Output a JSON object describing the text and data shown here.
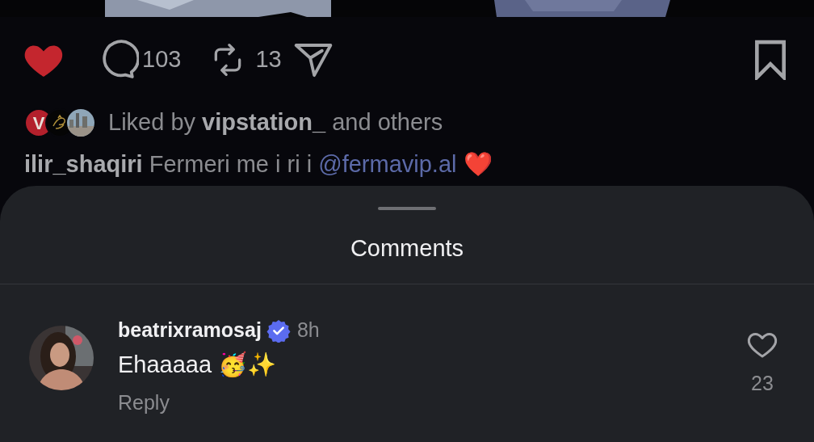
{
  "post": {
    "liked": true,
    "comment_count": "103",
    "repost_count": "13",
    "saved": false,
    "liked_by": {
      "avatars": [
        {
          "kind": "letter",
          "text": "V",
          "color": "#b3202c"
        },
        {
          "kind": "emblem"
        },
        {
          "kind": "picture"
        }
      ],
      "text": "Liked by **vipstation_** and others"
    },
    "caption": {
      "text": "**ilir_shaqiri** Fermeri me i ri i",
      "mention": "@fermavip.al",
      "emoji": "❤️"
    }
  },
  "comments_sheet": {
    "title": "Comments",
    "comments": [
      {
        "username": "beatrixramosaj",
        "verified": true,
        "time": "8h",
        "text": "Ehaaaaa 🥳✨",
        "reply": "Reply",
        "liked": false,
        "like_count": "23"
      }
    ]
  }
}
